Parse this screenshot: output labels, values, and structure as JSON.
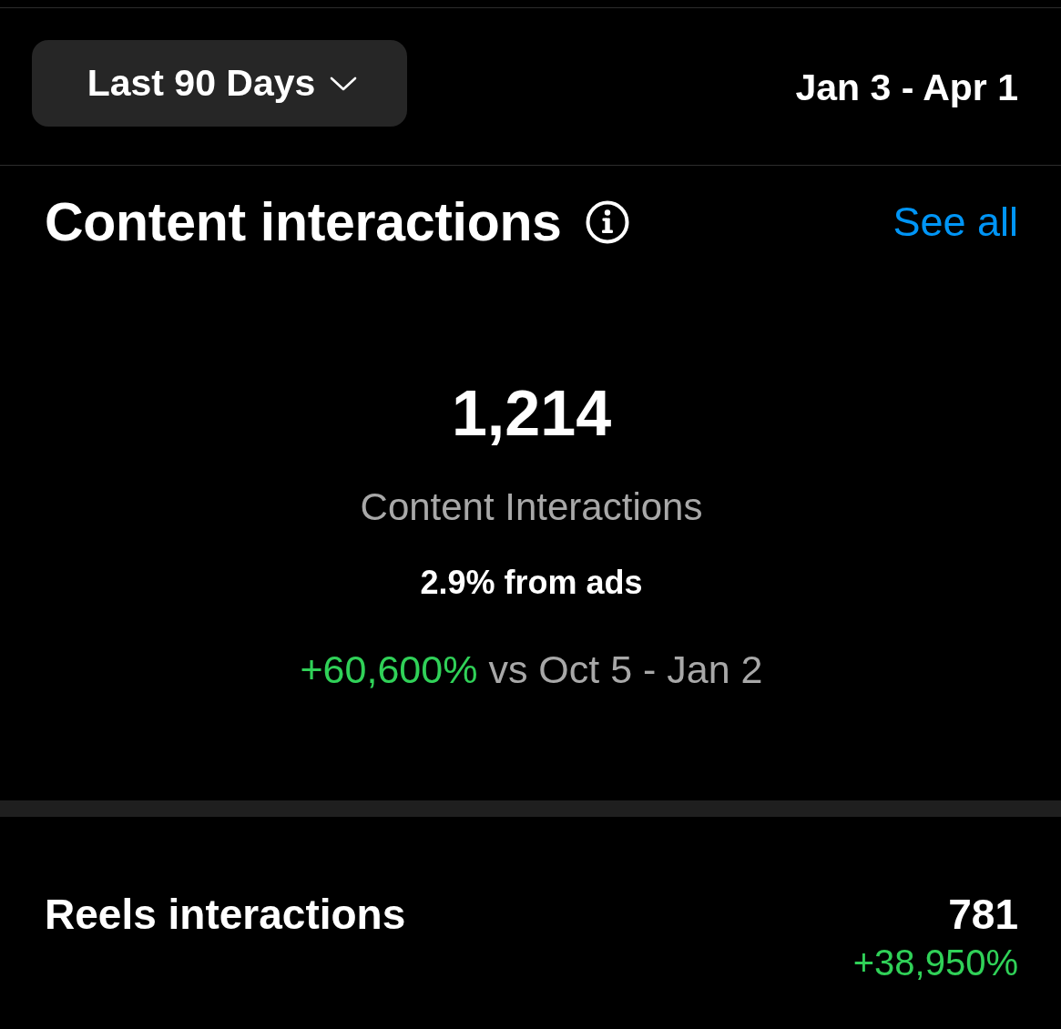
{
  "header": {
    "range_selector": {
      "label": "Last 90 Days"
    },
    "date_range": "Jan 3 - Apr 1"
  },
  "content_interactions": {
    "title": "Content interactions",
    "see_all": "See all",
    "total": "1,214",
    "total_label": "Content Interactions",
    "ads_share": "2.9% from ads",
    "change": {
      "value": "+60,600%",
      "positive": true,
      "comparison": "vs Oct 5 - Jan 2"
    }
  },
  "breakdown": [
    {
      "label": "Reels interactions",
      "value": "781",
      "change": "+38,950%",
      "positive": true
    }
  ]
}
